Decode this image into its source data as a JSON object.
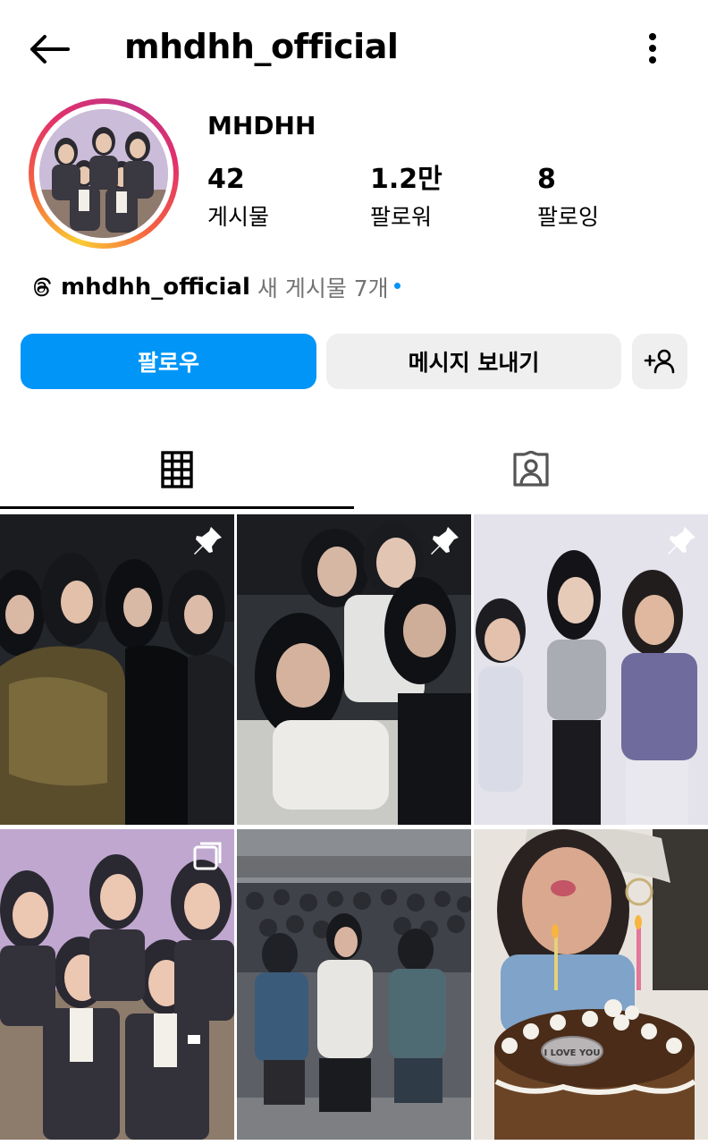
{
  "header": {
    "back_icon": "arrow-left-icon",
    "username": "mhdhh_official",
    "more_icon": "more-vertical-icon"
  },
  "profile": {
    "display_name": "MHDHH",
    "stats": [
      {
        "value": "42",
        "label": "게시물"
      },
      {
        "value": "1.2만",
        "label": "팔로워"
      },
      {
        "value": "8",
        "label": "팔로잉"
      }
    ],
    "threads": {
      "icon": "threads-icon",
      "handle": "mhdhh_official",
      "new_posts": "새 게시물 7개"
    }
  },
  "actions": {
    "follow_label": "팔로우",
    "message_label": "메시지 보내기",
    "suggest_icon": "add-person-icon"
  },
  "tabs": [
    {
      "name": "grid",
      "icon": "grid-icon",
      "active": true
    },
    {
      "name": "tagged",
      "icon": "tagged-person-icon",
      "active": false
    }
  ],
  "posts": [
    {
      "pinned": true,
      "icon": "pin-icon"
    },
    {
      "pinned": true,
      "icon": "pin-icon"
    },
    {
      "pinned": true,
      "icon": "pin-icon"
    },
    {
      "pinned": false,
      "multi": true,
      "icon": "carousel-icon"
    },
    {
      "pinned": false
    },
    {
      "pinned": false,
      "cake_text": "I LOVE YOU"
    }
  ],
  "colors": {
    "follow_blue": "#0095f6",
    "secondary_btn": "#efefef",
    "muted_text": "#737373"
  }
}
